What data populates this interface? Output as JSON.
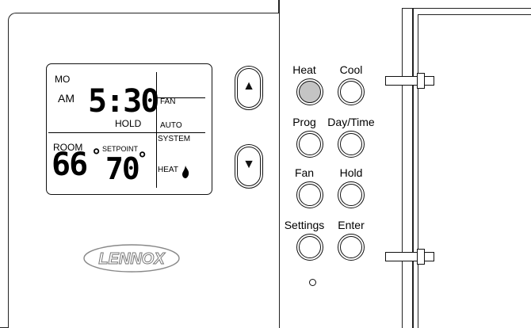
{
  "display": {
    "day": "MO",
    "ampm": "AM",
    "time": "5:30",
    "hold": "HOLD",
    "fan_label": "FAN",
    "fan_mode": "AUTO",
    "system_label": "SYSTEM",
    "system_mode": "HEAT",
    "room_label": "ROOM",
    "room_temp": "66",
    "setpoint_label": "SETPOINT",
    "setpoint_temp": "70",
    "degree": "°"
  },
  "arrows": {
    "up": "▲",
    "down": "▼"
  },
  "buttons": {
    "heat": "Heat",
    "cool": "Cool",
    "prog": "Prog",
    "daytime": "Day/Time",
    "fan": "Fan",
    "hold": "Hold",
    "settings": "Settings",
    "enter": "Enter"
  },
  "brand": "LENNOX",
  "icons": {
    "flame": "flame-icon",
    "indicator": "status-led-icon"
  },
  "colors": {
    "active_button": "#c4c4c4",
    "outline": "#111111"
  }
}
